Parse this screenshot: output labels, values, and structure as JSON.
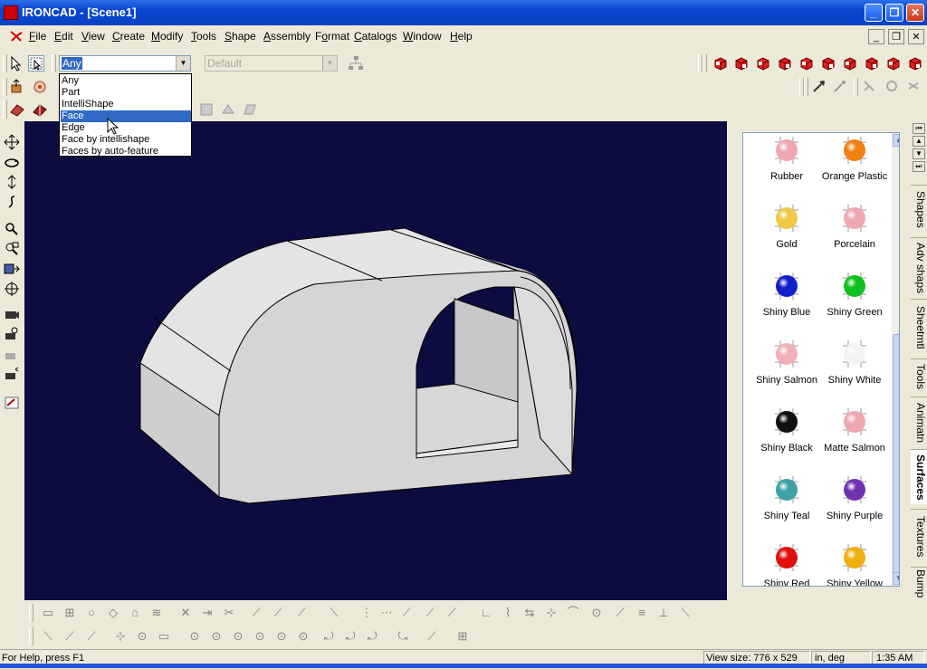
{
  "window": {
    "title": "IRONCAD - [Scene1]"
  },
  "menu": {
    "items": [
      {
        "label": "File",
        "key": "F"
      },
      {
        "label": "Edit",
        "key": "E"
      },
      {
        "label": "View",
        "key": "V"
      },
      {
        "label": "Create",
        "key": "C"
      },
      {
        "label": "Modify",
        "key": "M"
      },
      {
        "label": "Tools",
        "key": "T"
      },
      {
        "label": "Shape",
        "key": "S"
      },
      {
        "label": "Assembly",
        "key": "A"
      },
      {
        "label": "Format",
        "key": "o"
      },
      {
        "label": "Catalogs",
        "key": "C"
      },
      {
        "label": "Window",
        "key": "W"
      },
      {
        "label": "Help",
        "key": "H"
      }
    ]
  },
  "selection": {
    "filter_value": "Any",
    "filter_options": [
      "Any",
      "Part",
      "IntelliShape",
      "Face",
      "Edge",
      "Face by intellishape",
      "Faces by auto-feature"
    ],
    "highlighted_option": "Face",
    "style_value": "Default"
  },
  "catalog": {
    "items": [
      {
        "label": "Rubber",
        "color": "#f0a8b0"
      },
      {
        "label": "Orange Plastic",
        "color": "#f08010"
      },
      {
        "label": "Gold",
        "color": "#f0c848"
      },
      {
        "label": "Porcelain",
        "color": "#f0a8b0"
      },
      {
        "label": "Shiny Blue",
        "color": "#1020c8"
      },
      {
        "label": "Shiny Green",
        "color": "#10c020"
      },
      {
        "label": "Shiny Salmon",
        "color": "#f0b0b8"
      },
      {
        "label": "Shiny White",
        "color": "#f4f4f4"
      },
      {
        "label": "Shiny Black",
        "color": "#101010"
      },
      {
        "label": "Matte Salmon",
        "color": "#f0a8b0"
      },
      {
        "label": "Shiny Teal",
        "color": "#40a0a8"
      },
      {
        "label": "Shiny Purple",
        "color": "#7030b0"
      },
      {
        "label": "Shiny Red",
        "color": "#e01010"
      },
      {
        "label": "Shiny Yellow",
        "color": "#f0b010"
      }
    ],
    "tabs": [
      "Shapes",
      "Adv shaps",
      "Sheetmtl",
      "Tools",
      "Animatn",
      "Surfaces",
      "Textures",
      "Bump"
    ],
    "active_tab": "Surfaces"
  },
  "status": {
    "help": "For Help, press F1",
    "view_size": "View size:  776 x  529",
    "units": "in, deg",
    "time": "1:35 AM"
  },
  "colors": {
    "viewport_bg": "#0c0c40",
    "model_face": "#d8d8d8",
    "highlight": "#316ac5"
  }
}
